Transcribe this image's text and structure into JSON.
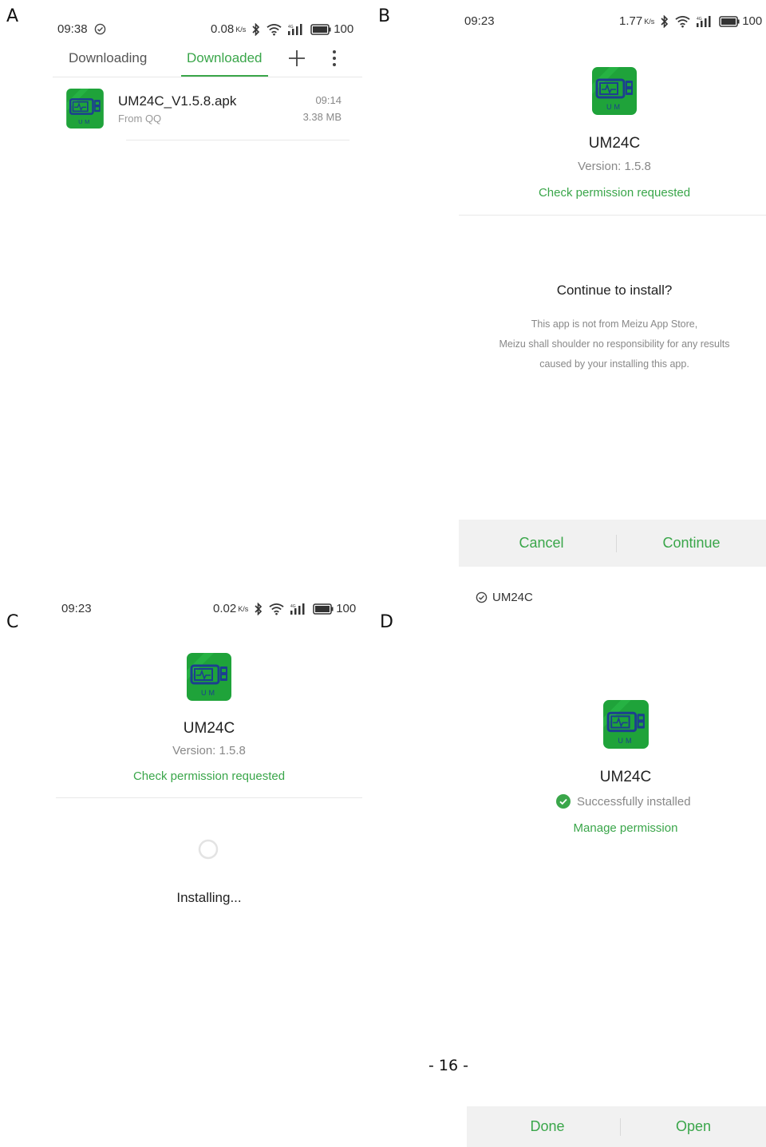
{
  "labels": {
    "a": "A",
    "b": "B",
    "c": "C",
    "d": "D"
  },
  "colors": {
    "accent_green": "#3aa64a",
    "icon_green": "#1fa33a",
    "icon_blue": "#1c3f8f",
    "bar_bg": "#f1f1f1"
  },
  "panel_a": {
    "status": {
      "time": "09:38",
      "speed": "0.08",
      "speed_unit": "K/s",
      "battery": "100"
    },
    "tabs": [
      {
        "label": "Downloading"
      },
      {
        "label": "Downloaded"
      }
    ],
    "active_tab": "Downloaded",
    "icons": [
      "plus-icon",
      "more-vertical-icon"
    ],
    "file": {
      "name": "UM24C_V1.5.8.apk",
      "source": "From QQ",
      "time": "09:14",
      "size": "3.38 MB"
    }
  },
  "panel_b": {
    "status": {
      "time": "09:23",
      "speed": "1.77",
      "speed_unit": "K/s",
      "battery": "100"
    },
    "app_name": "UM24C",
    "version": "Version: 1.5.8",
    "permission_link": "Check permission requested",
    "dialog_title": "Continue to install?",
    "dialog_lines": [
      "This app is not from Meizu App Store,",
      "Meizu shall shoulder no responsibility for any results",
      "caused by your installing this app."
    ],
    "cancel": "Cancel",
    "continue": "Continue"
  },
  "panel_c": {
    "status": {
      "time": "09:23",
      "speed": "0.02",
      "speed_unit": "K/s",
      "battery": "100"
    },
    "app_name": "UM24C",
    "version": "Version: 1.5.8",
    "permission_link": "Check permission requested",
    "installing": "Installing..."
  },
  "panel_d": {
    "notification": "UM24C",
    "app_name": "UM24C",
    "status_text": "Successfully installed",
    "manage_link": "Manage permission",
    "done": "Done",
    "open": "Open"
  },
  "page_number": "- 16 -",
  "icon_text": "UM"
}
